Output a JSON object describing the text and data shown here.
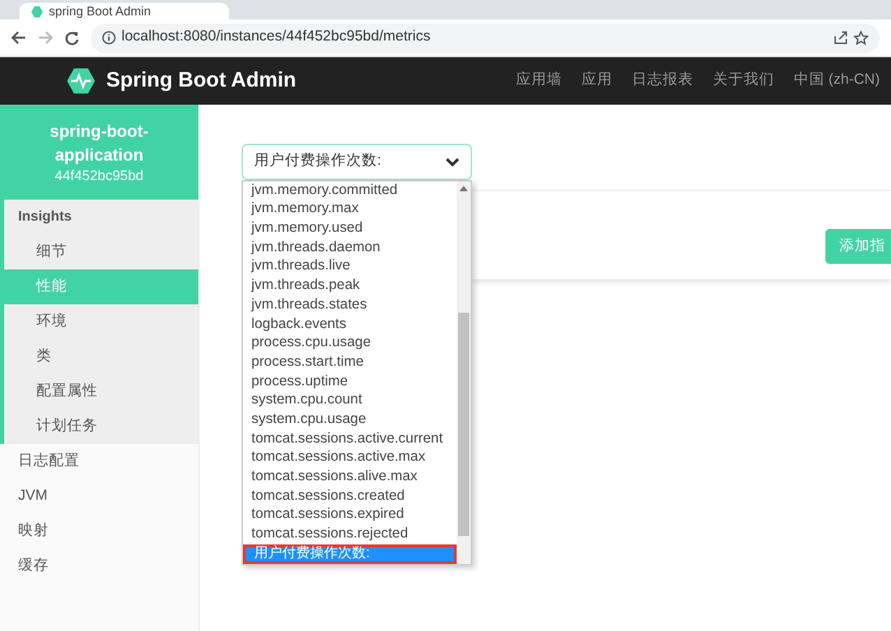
{
  "browser": {
    "tab_title": "spring Boot Admin",
    "url": "localhost:8080/instances/44f452bc95bd/metrics"
  },
  "navbar": {
    "brand": "Spring Boot Admin",
    "links": [
      "应用墙",
      "应用",
      "日志报表",
      "关于我们",
      "中国 (zh-CN)"
    ]
  },
  "sidebar": {
    "app_name": "spring-boot-application",
    "instance_id": "44f452bc95bd",
    "section": "Insights",
    "insights": [
      {
        "label": "细节",
        "selected": false
      },
      {
        "label": "性能",
        "selected": true
      },
      {
        "label": "环境",
        "selected": false
      },
      {
        "label": "类",
        "selected": false
      },
      {
        "label": "配置属性",
        "selected": false
      },
      {
        "label": "计划任务",
        "selected": false
      }
    ],
    "items": [
      "日志配置",
      "JVM",
      "映射",
      "缓存"
    ]
  },
  "metric_select": {
    "value": "用户付费操作次数:",
    "options": [
      {
        "label": "jvm.memory.committed",
        "selected": false
      },
      {
        "label": "jvm.memory.max",
        "selected": false
      },
      {
        "label": "jvm.memory.used",
        "selected": false
      },
      {
        "label": "jvm.threads.daemon",
        "selected": false
      },
      {
        "label": "jvm.threads.live",
        "selected": false
      },
      {
        "label": "jvm.threads.peak",
        "selected": false
      },
      {
        "label": "jvm.threads.states",
        "selected": false
      },
      {
        "label": "logback.events",
        "selected": false
      },
      {
        "label": "process.cpu.usage",
        "selected": false
      },
      {
        "label": "process.start.time",
        "selected": false
      },
      {
        "label": "process.uptime",
        "selected": false
      },
      {
        "label": "system.cpu.count",
        "selected": false
      },
      {
        "label": "system.cpu.usage",
        "selected": false
      },
      {
        "label": "tomcat.sessions.active.current",
        "selected": false
      },
      {
        "label": "tomcat.sessions.active.max",
        "selected": false
      },
      {
        "label": "tomcat.sessions.alive.max",
        "selected": false
      },
      {
        "label": "tomcat.sessions.created",
        "selected": false
      },
      {
        "label": "tomcat.sessions.expired",
        "selected": false
      },
      {
        "label": "tomcat.sessions.rejected",
        "selected": false
      },
      {
        "label": "用户付费操作次数:",
        "selected": true
      }
    ]
  },
  "add_button": "添加指"
}
